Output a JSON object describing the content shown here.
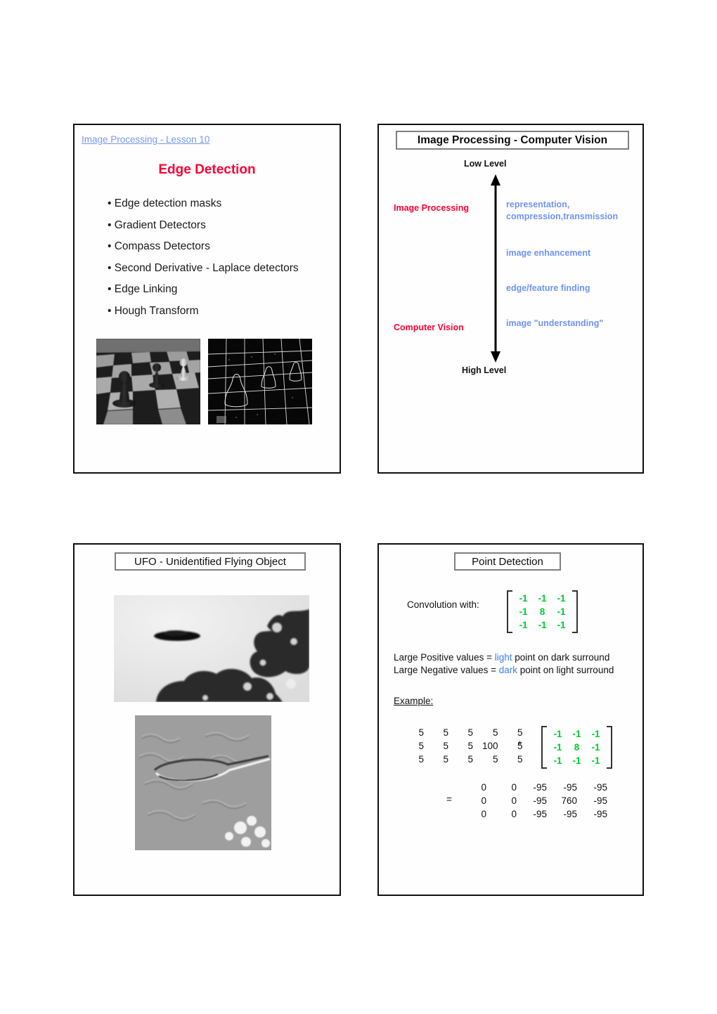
{
  "page": {
    "kind": "lecture-slide-handout",
    "slide_count": 4
  },
  "slides": {
    "edge_detection": {
      "lesson_link": "Image Processing - Lesson 10",
      "title": "Edge Detection",
      "bullets": [
        "Edge detection masks",
        "Gradient Detectors",
        "Compass Detectors",
        "Second Derivative - Laplace detectors",
        "Edge Linking",
        "Hough Transform"
      ],
      "images": [
        {
          "name": "chessboard-grayscale-photo",
          "alt": "Grayscale photo of chess pieces on a checkerboard"
        },
        {
          "name": "chessboard-edge-map",
          "alt": "Edge-detected version of the chessboard photo"
        }
      ],
      "colors": {
        "title": "#ff0033",
        "link": "#7799ee"
      }
    },
    "computer_vision": {
      "title": "Image Processing - Computer Vision",
      "axis_top_label": "Low Level",
      "axis_bottom_label": "High Level",
      "stages": [
        {
          "label": "Image Processing"
        },
        {
          "label": "Computer Vision"
        }
      ],
      "tasks": [
        {
          "line1": "representation,",
          "line2": "compression,transmission"
        },
        {
          "line1": "image enhancement",
          "line2": ""
        },
        {
          "line1": "edge/feature finding",
          "line2": ""
        },
        {
          "line1": "image \"understanding\"",
          "line2": ""
        }
      ],
      "colors": {
        "stage": "#ff0033",
        "task": "#6e94f5"
      }
    },
    "ufo": {
      "title": "UFO - Unidentified Flying Object",
      "images": [
        {
          "name": "ufo-photograph",
          "alt": "Black and white photograph of a disc-shaped UFO above treetops"
        },
        {
          "name": "ufo-embossed-edge-image",
          "alt": "Embossed / edge-filtered version of the UFO photograph"
        }
      ]
    },
    "point_detection": {
      "title": "Point Detection",
      "convolution_label": "Convolution with:",
      "kernel": [
        [
          "-1",
          "-1",
          "-1"
        ],
        [
          "-1",
          "8",
          "-1"
        ],
        [
          "-1",
          "-1",
          "-1"
        ]
      ],
      "description": {
        "positive_prefix": "Large Positive values = ",
        "positive_highlight": "light",
        "positive_suffix": " point on dark surround",
        "negative_prefix": "Large Negative values = ",
        "negative_highlight": "dark",
        "negative_suffix": " point on light surround"
      },
      "example_label": "Example:",
      "input_matrix": [
        [
          "5",
          "5",
          "5",
          "5",
          "5"
        ],
        [
          "5",
          "5",
          "5",
          "100",
          "5"
        ],
        [
          "5",
          "5",
          "5",
          "5",
          "5"
        ]
      ],
      "operator_convolve": "*",
      "operator_equals": "=",
      "output_matrix": [
        [
          "0",
          "0",
          "-95",
          "-95",
          "-95"
        ],
        [
          "0",
          "0",
          "-95",
          "760",
          "-95"
        ],
        [
          "0",
          "0",
          "-95",
          "-95",
          "-95"
        ]
      ],
      "colors": {
        "kernel": "#00cc33",
        "highlight": "#3b7ff0"
      }
    }
  }
}
